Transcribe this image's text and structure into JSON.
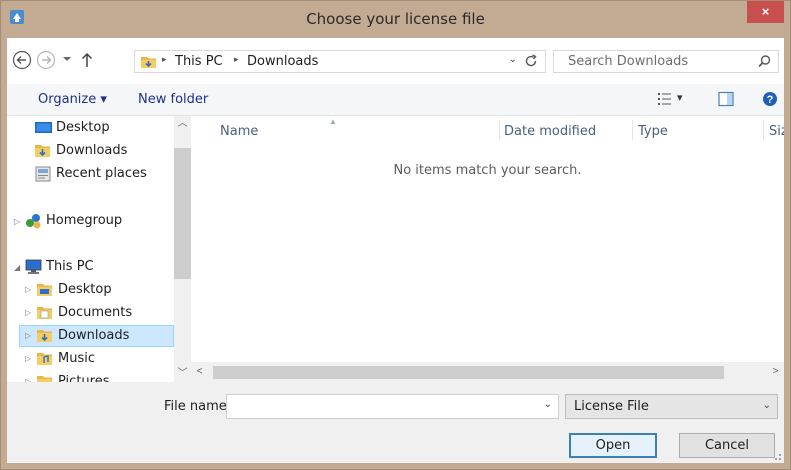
{
  "window": {
    "title": "Choose your license file",
    "close_label": "×"
  },
  "address": {
    "crumbs": [
      "This PC",
      "Downloads"
    ],
    "separator": "▸",
    "dropdown": "⌄"
  },
  "search": {
    "placeholder": "Search Downloads"
  },
  "toolbar": {
    "organize_label": "Organize ▾",
    "new_folder_label": "New folder",
    "views_dropdown": "▾"
  },
  "nav_pane": {
    "items": [
      {
        "label": "Desktop",
        "icon": "desktop-icon"
      },
      {
        "label": "Downloads",
        "icon": "downloads-folder-icon"
      },
      {
        "label": "Recent places",
        "icon": "recent-places-icon"
      },
      {
        "label": "Homegroup",
        "icon": "homegroup-icon"
      },
      {
        "label": "This PC",
        "icon": "computer-icon"
      },
      {
        "label": "Desktop",
        "icon": "desktop-folder-icon"
      },
      {
        "label": "Documents",
        "icon": "documents-folder-icon"
      },
      {
        "label": "Downloads",
        "icon": "downloads-folder-icon",
        "selected": true
      },
      {
        "label": "Music",
        "icon": "music-folder-icon"
      },
      {
        "label": "Pictures",
        "icon": "pictures-folder-icon"
      }
    ]
  },
  "file_list": {
    "columns": [
      "Name",
      "Date modified",
      "Type",
      "Size"
    ],
    "empty_message": "No items match your search."
  },
  "bottom": {
    "file_name_label": "File name:",
    "file_name_value": "",
    "file_type_selected": "License File",
    "open_label": "Open",
    "cancel_label": "Cancel"
  },
  "colors": {
    "frame": "#c3ab93",
    "close_button": "#c7504f",
    "selection": "#cce8ff",
    "link_text": "#1e3287"
  }
}
